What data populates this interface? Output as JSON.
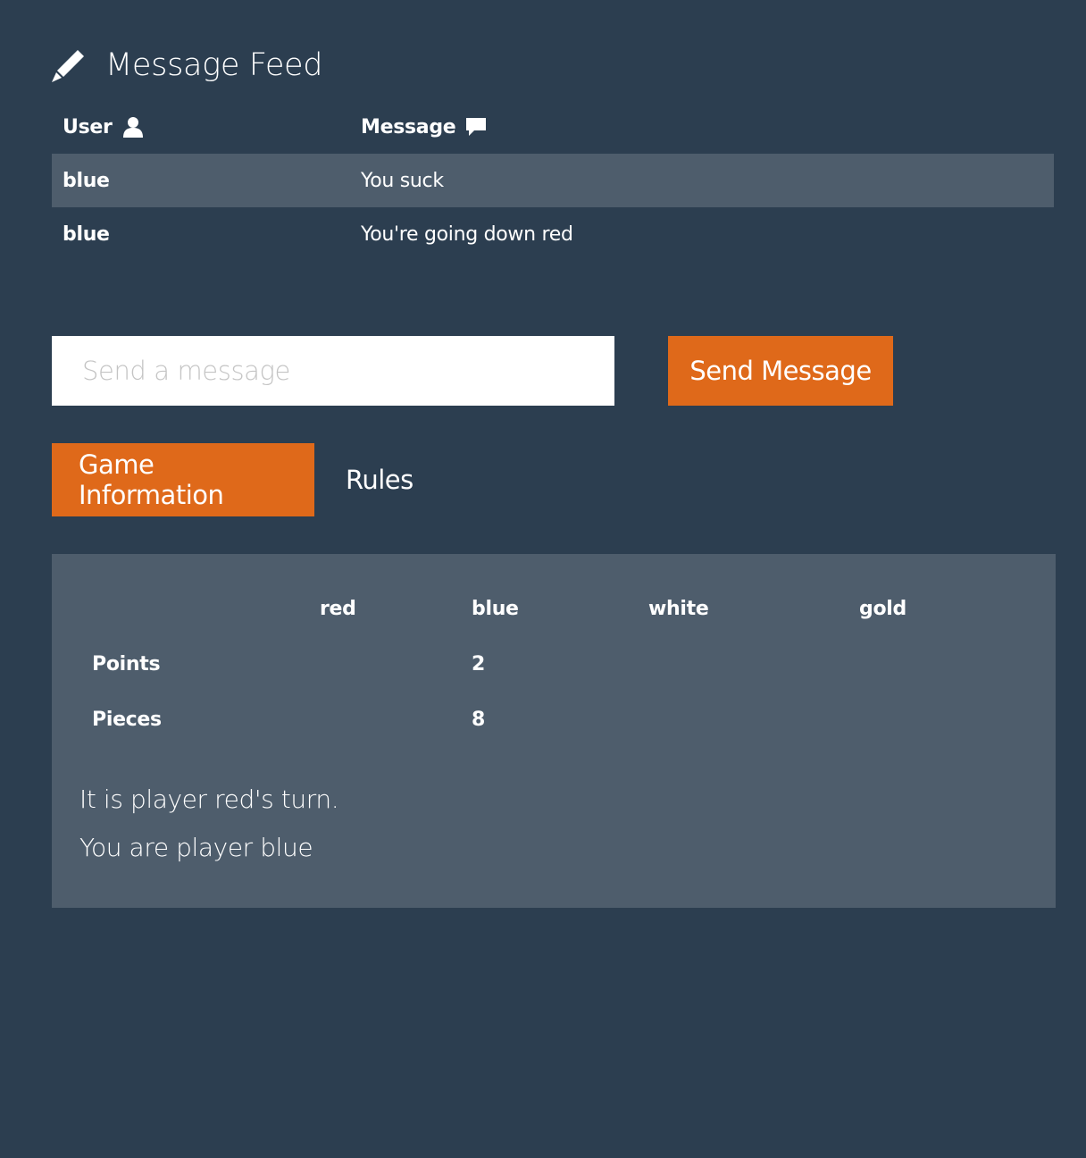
{
  "feed": {
    "title": "Message Feed",
    "icon": "pencil-icon",
    "columns": {
      "user": "User",
      "user_icon": "user-icon",
      "message": "Message",
      "message_icon": "comment-icon"
    },
    "rows": [
      {
        "user": "blue",
        "message": "You suck"
      },
      {
        "user": "blue",
        "message": "You're going down red"
      }
    ]
  },
  "compose": {
    "placeholder": "Send a message",
    "value": "",
    "send_label": "Send Message"
  },
  "tabs": [
    {
      "label": "Game Information",
      "active": true
    },
    {
      "label": "Rules",
      "active": false
    }
  ],
  "game_info": {
    "headers": [
      "",
      "red",
      "blue",
      "white",
      "gold"
    ],
    "rows": [
      {
        "label": "Points",
        "values": [
          "",
          "2",
          "",
          ""
        ]
      },
      {
        "label": "Pieces",
        "values": [
          "",
          "8",
          "",
          ""
        ]
      }
    ],
    "turn_text": "It is player red's turn.",
    "player_text": "You are player blue"
  },
  "colors": {
    "background": "#2c3e50",
    "panel": "#4e5d6c",
    "accent": "#df691a",
    "text": "#ffffff"
  }
}
